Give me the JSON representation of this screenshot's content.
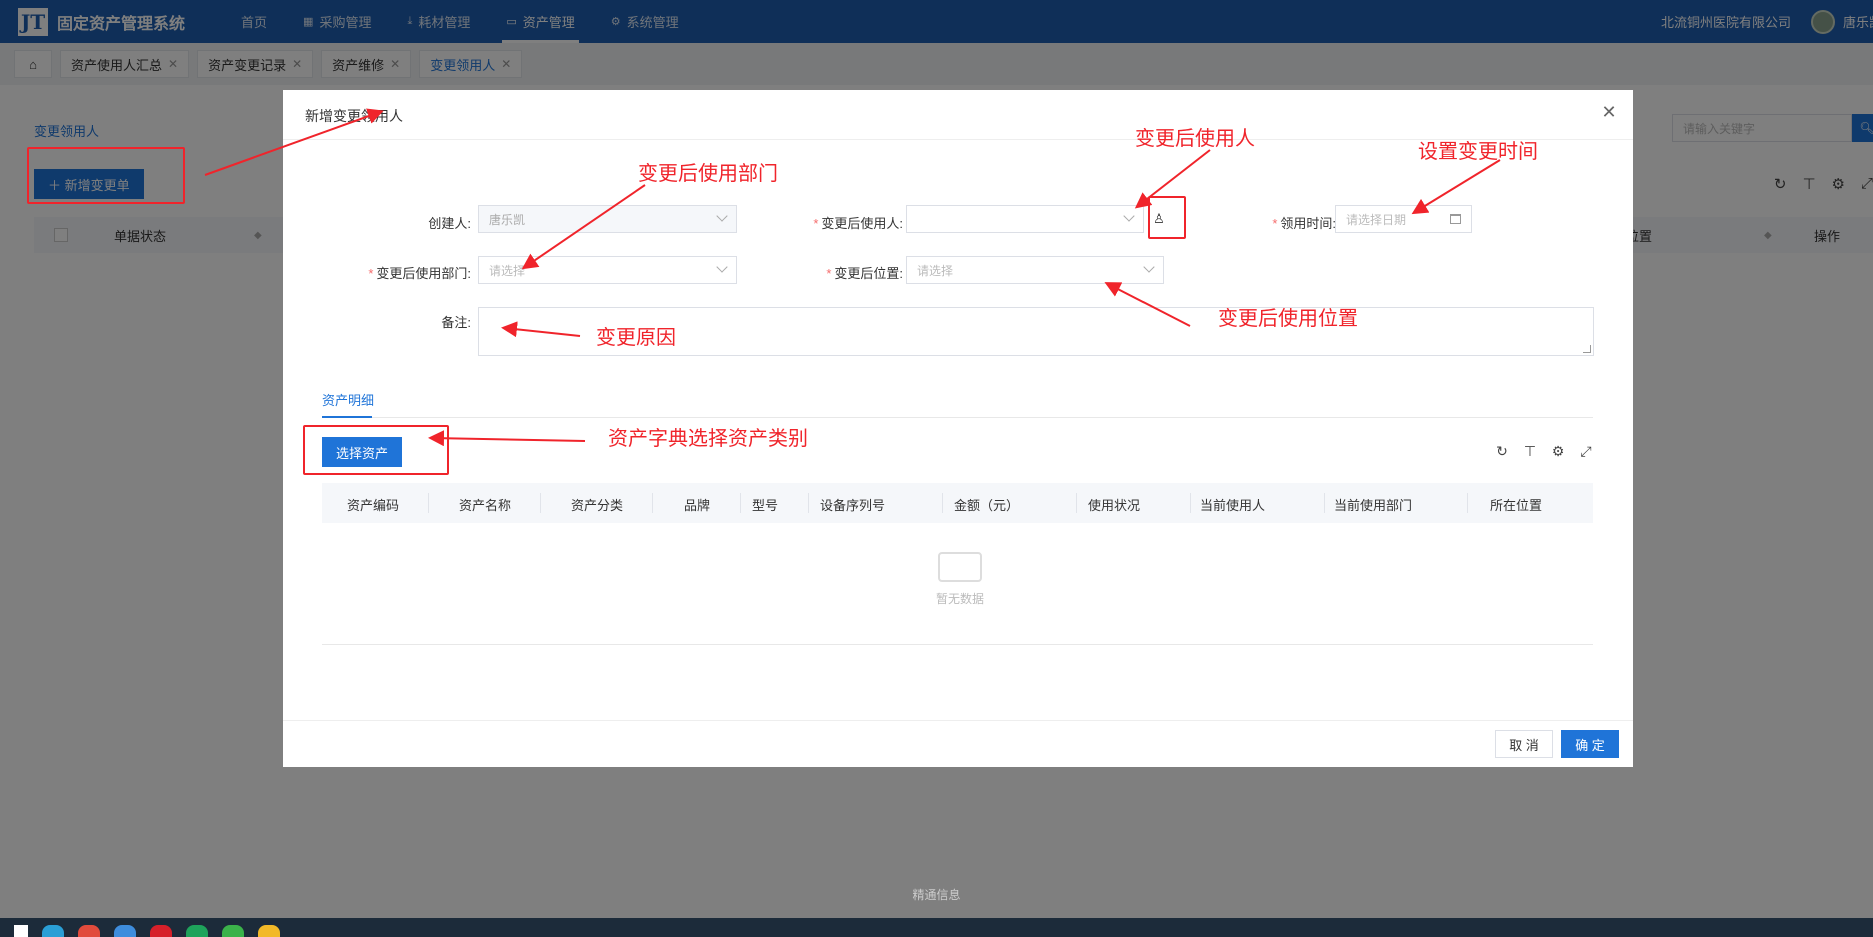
{
  "header": {
    "logo": "JT",
    "title": "固定资产管理系统",
    "nav": [
      {
        "label": "首页",
        "icon": ""
      },
      {
        "label": "采购管理",
        "icon": "grid-icon"
      },
      {
        "label": "耗材管理",
        "icon": "download-icon"
      },
      {
        "label": "资产管理",
        "icon": "calendar-icon"
      },
      {
        "label": "系统管理",
        "icon": "gear-icon"
      }
    ],
    "company": "北流铜州医院有限公司",
    "user": "唐乐凯"
  },
  "tabs": [
    {
      "label": "资产使用人汇总"
    },
    {
      "label": "资产变更记录"
    },
    {
      "label": "资产维修"
    },
    {
      "label": "变更领用人"
    }
  ],
  "background": {
    "page_title": "变更领用人",
    "add_button": "＋ 新增变更单",
    "search_placeholder": "请输入关键字",
    "col_status": "单据状态",
    "col_location": "位置",
    "col_action": "操作"
  },
  "modal": {
    "title": "新增变更领用人",
    "creator_label": "创建人:",
    "creator_value": "唐乐凯",
    "new_user_label": "变更后使用人:",
    "receive_time_label": "领用时间:",
    "receive_time_placeholder": "请选择日期",
    "new_dept_label": "变更后使用部门:",
    "new_dept_placeholder": "请选择",
    "new_location_label": "变更后位置:",
    "new_location_placeholder": "请选择",
    "remark_label": "备注:",
    "detail_tab": "资产明细",
    "select_asset_button": "选择资产",
    "columns": [
      "资产编码",
      "资产名称",
      "资产分类",
      "品牌",
      "型号",
      "设备序列号",
      "金额（元）",
      "使用状况",
      "当前使用人",
      "当前使用部门",
      "所在位置"
    ],
    "empty_text": "暂无数据",
    "cancel_button": "取 消",
    "ok_button": "确 定"
  },
  "annotations": {
    "new_user": "变更后使用人",
    "receive_time": "设置变更时间",
    "new_dept": "变更后使用部门",
    "new_location": "变更后使用位置",
    "remark": "变更原因",
    "select_asset": "资产字典选择资产类别"
  },
  "footer": "精通信息",
  "colors": {
    "primary": "#1f74d8",
    "header": "#1f5fb0",
    "annotation": "#f0242b"
  }
}
